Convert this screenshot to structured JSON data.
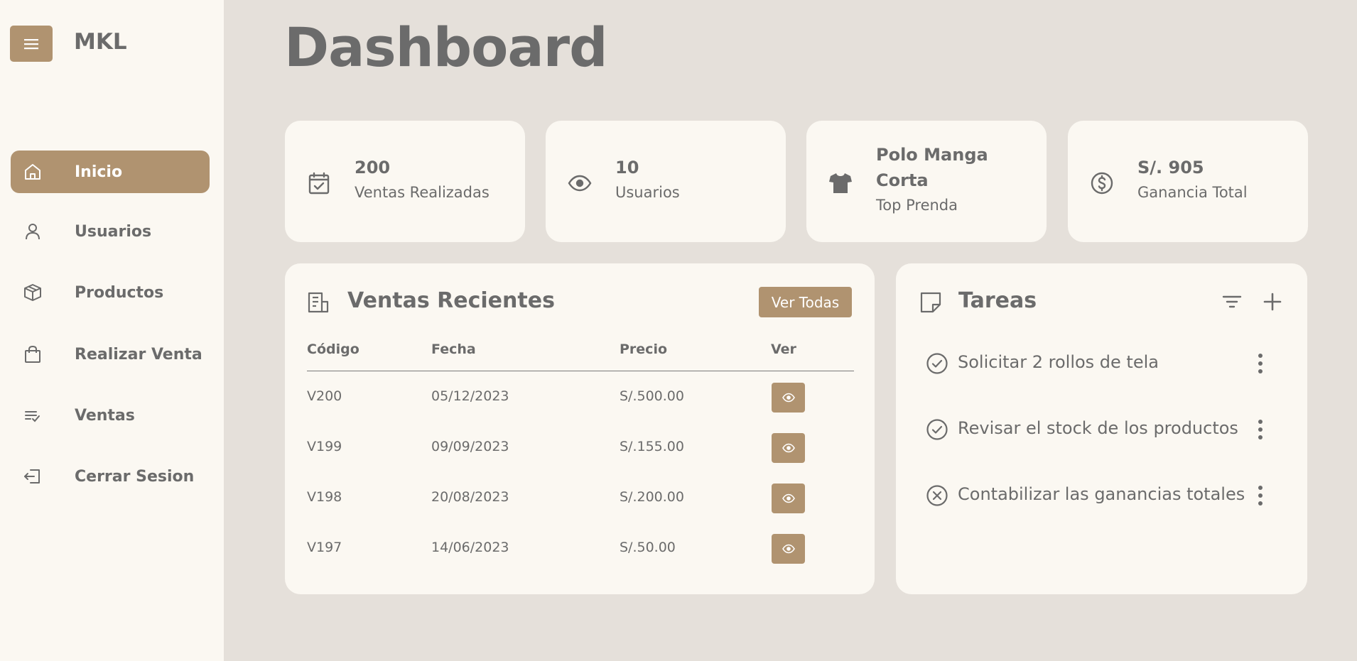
{
  "sidebar": {
    "brand": "MKL",
    "menu_icon": "hamburger-icon",
    "items": [
      {
        "label": "Inicio",
        "icon": "home-icon",
        "active": true
      },
      {
        "label": "Usuarios",
        "icon": "user-icon",
        "active": false
      },
      {
        "label": "Productos",
        "icon": "box-icon",
        "active": false
      },
      {
        "label": "Realizar Venta",
        "icon": "shopping-bag-icon",
        "active": false
      },
      {
        "label": "Ventas",
        "icon": "list-check-icon",
        "active": false
      },
      {
        "label": "Cerrar Sesion",
        "icon": "logout-icon",
        "active": false
      }
    ]
  },
  "page": {
    "title": "Dashboard"
  },
  "stats": [
    {
      "value": "200",
      "label": "Ventas Realizadas",
      "icon": "calendar-check-icon"
    },
    {
      "value": "10",
      "label": "Usuarios",
      "icon": "eye-icon"
    },
    {
      "value": "Polo Manga Corta",
      "label": "Top Prenda",
      "icon": "tshirt-icon"
    },
    {
      "value": "S/. 905",
      "label": "Ganancia Total",
      "icon": "dollar-circle-icon"
    }
  ],
  "ventas": {
    "title": "Ventas Recientes",
    "button": "Ver Todas",
    "columns": [
      "Código",
      "Fecha",
      "Precio",
      "Ver"
    ],
    "rows": [
      {
        "codigo": "V200",
        "fecha": "05/12/2023",
        "precio": "S/.500.00"
      },
      {
        "codigo": "V199",
        "fecha": "09/09/2023",
        "precio": "S/.155.00"
      },
      {
        "codigo": "V198",
        "fecha": "20/08/2023",
        "precio": "S/.200.00"
      },
      {
        "codigo": "V197",
        "fecha": "14/06/2023",
        "precio": "S/.50.00"
      }
    ]
  },
  "tareas": {
    "title": "Tareas",
    "items": [
      {
        "text": "Solicitar 2 rollos de tela",
        "status": "done"
      },
      {
        "text": "Revisar el stock de los productos",
        "status": "done"
      },
      {
        "text": "Contabilizar las ganancias totales",
        "status": "cancelled"
      }
    ]
  },
  "colors": {
    "accent": "#b09370",
    "sidebar_bg": "#fbf8f2",
    "page_bg": "#e5e0da",
    "text": "#6b6b6b"
  }
}
